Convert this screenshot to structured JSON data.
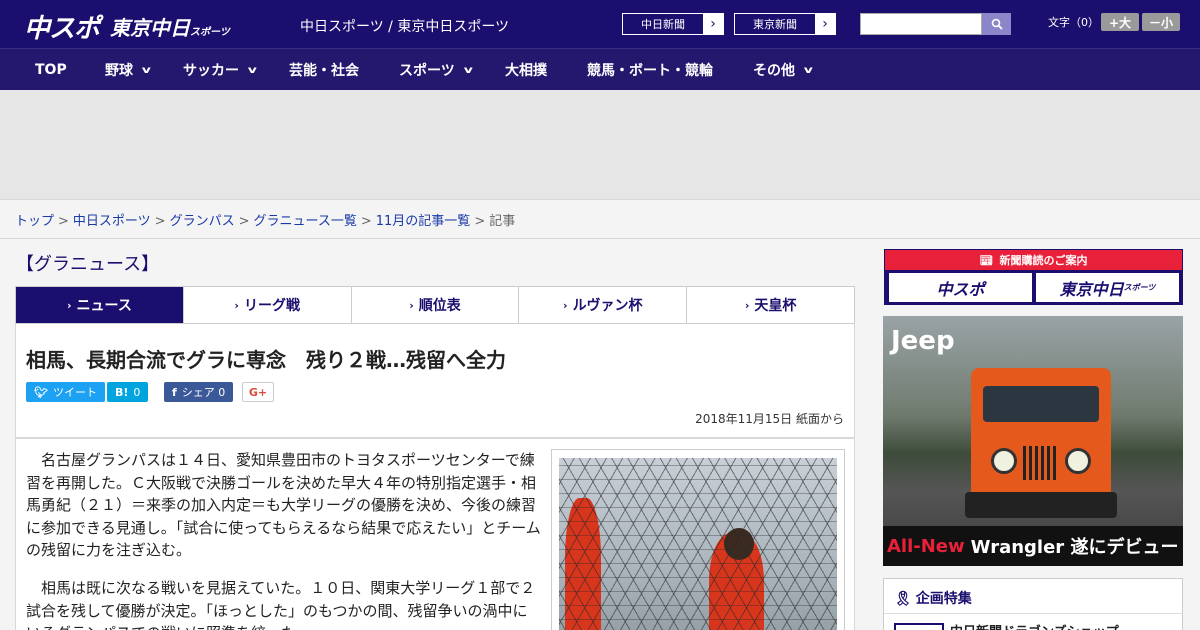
{
  "header": {
    "logo_chunichi": "中スポ",
    "logo_tokyo": "東京中日",
    "logo_tokyo_sub": "スポーツ",
    "site_links": "中日スポーツ / 東京中日スポーツ",
    "paper_buttons": [
      "中日新聞",
      "東京新聞"
    ],
    "search_placeholder": "",
    "font_size_label": "文字（0）",
    "font_bigger": "+大",
    "font_smaller": "－小"
  },
  "nav": {
    "items": [
      {
        "label": "TOP",
        "has_menu": false
      },
      {
        "label": "野球",
        "has_menu": true
      },
      {
        "label": "サッカー",
        "has_menu": true
      },
      {
        "label": "芸能・社会",
        "has_menu": false
      },
      {
        "label": "スポーツ",
        "has_menu": true
      },
      {
        "label": "大相撲",
        "has_menu": false
      },
      {
        "label": "競馬・ボート・競輪",
        "has_menu": false
      },
      {
        "label": "その他",
        "has_menu": true
      }
    ]
  },
  "breadcrumb": {
    "items": [
      "トップ",
      "中日スポーツ",
      "グランパス",
      "グラニュース一覧",
      "11月の記事一覧"
    ],
    "current": "記事"
  },
  "section_title": "【グラニュース】",
  "tabs": [
    "ニュース",
    "リーグ戦",
    "順位表",
    "ルヴァン杯",
    "天皇杯"
  ],
  "article": {
    "headline": "相馬、長期合流でグラに専念　残り２戦…残留へ全力",
    "share": {
      "tweet": "ツイート",
      "hatena_count": "0",
      "facebook": "シェア",
      "facebook_count": "0",
      "gplus": "G+"
    },
    "date": "2018年11月15日 紙面から",
    "paragraphs": [
      "名古屋グランパスは１４日、愛知県豊田市のトヨタスポーツセンターで練習を再開した。Ｃ大阪戦で決勝ゴールを決めた早大４年の特別指定選手・相馬勇紀（２１）＝来季の加入内定＝も大学リーグの優勝を決め、今後の練習に参加できる見通し。「試合に使ってもらえるなら結果で応えたい」とチームの残留に力を注ぎ込む。",
      "相馬は既に次なる戦いを見据えていた。１０日、関東大学リーグ１部で２試合を残して優勝が決定。「ほっとした」のもつかの間、残留争いの渦中にいるグランパスでの戦いに照準を絞った。"
    ]
  },
  "sidebar": {
    "subscribe_head": "新聞購読のご案内",
    "subscribe_logos": [
      "中スポ",
      "東京中日"
    ],
    "subscribe_logo_sub": "スポーツ",
    "ad_brand": "Jeep",
    "ad_tagline_red": "All-New",
    "ad_tagline": "Wrangler 遂にデビュー",
    "feature_head": "企画特集",
    "feature_item": "中日新聞ドラゴンズショップ"
  },
  "colors": {
    "brand_navy": "#1a0f6e",
    "nav_bg": "#24176e",
    "twitter": "#1da1f2",
    "hatena": "#00a4de",
    "facebook": "#3b5998",
    "subscribe_red": "#e8203a"
  }
}
